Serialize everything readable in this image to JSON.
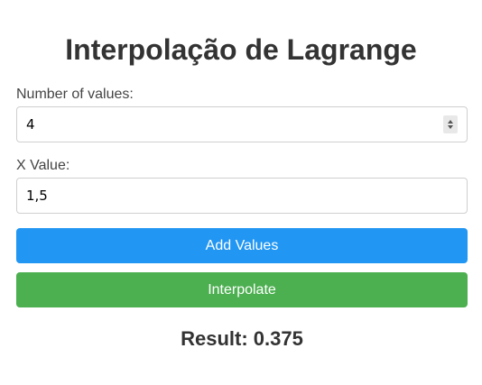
{
  "page": {
    "title": "Interpolação de Lagrange"
  },
  "form": {
    "count_label": "Number of values:",
    "count_value": "4",
    "x_label": "X Value:",
    "x_value": "1,5"
  },
  "buttons": {
    "add_label": "Add Values",
    "interpolate_label": "Interpolate"
  },
  "result": {
    "text": "Result: 0.375"
  },
  "colors": {
    "add_button": "#2196f3",
    "interpolate_button": "#4caf50",
    "title_text": "#333333"
  }
}
